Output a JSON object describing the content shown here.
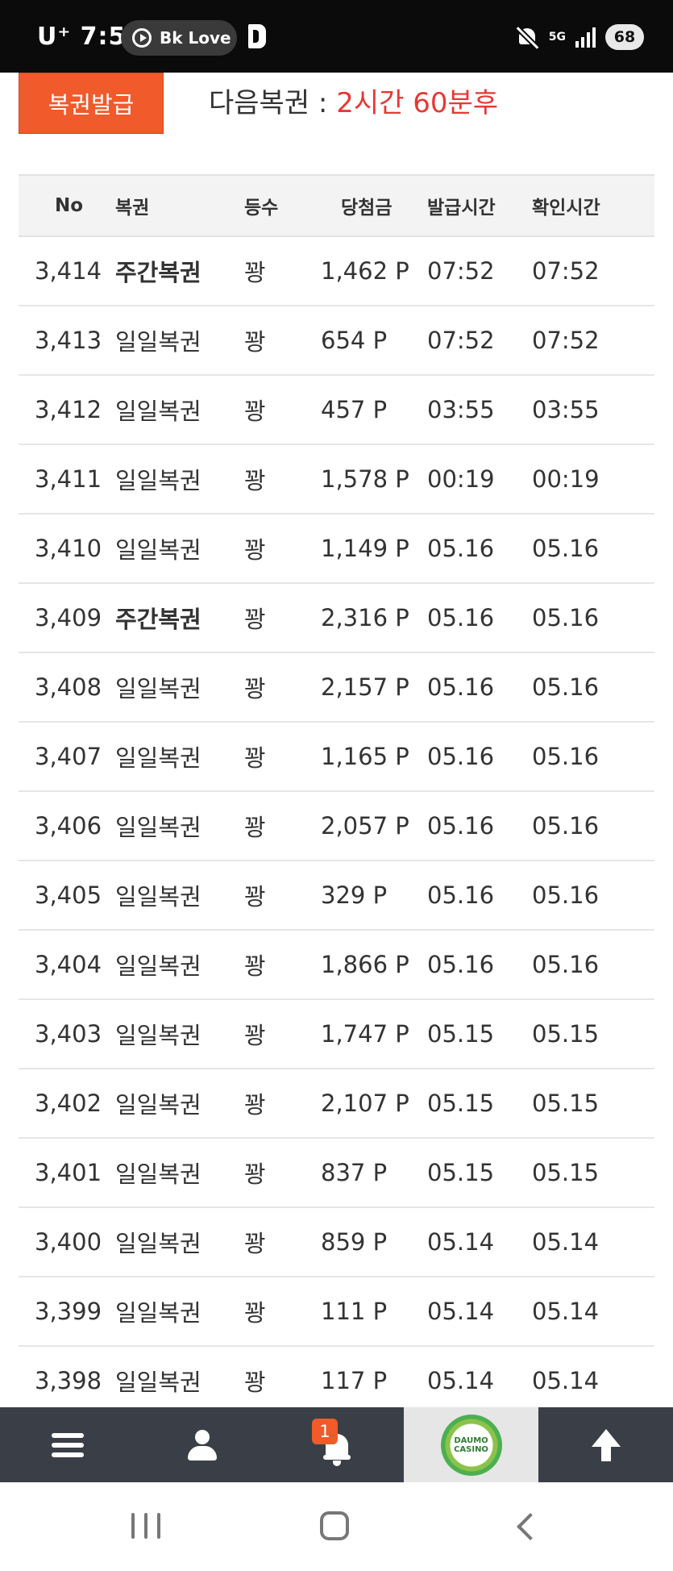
{
  "status_bar": {
    "carrier": "U⁺ 7:53",
    "media_pill_label": "Bk Love",
    "network": "5G",
    "battery": "68",
    "icons": [
      "play-icon",
      "b-app-icon",
      "mute-icon",
      "signal-icon",
      "battery-icon"
    ]
  },
  "top": {
    "issue_button_label": "복권발급",
    "next_label": "다음복권 : ",
    "next_value": "2시간 60분후"
  },
  "table": {
    "headers": [
      "No",
      "복권",
      "등수",
      "당첨금",
      "발급시간",
      "확인시간"
    ],
    "rows": [
      {
        "no": "3,414",
        "type": "주간복권",
        "rank": "꽝",
        "prize": "1,462 P",
        "issued": "07:52",
        "checked": "07:52"
      },
      {
        "no": "3,413",
        "type": "일일복권",
        "rank": "꽝",
        "prize": "654 P",
        "issued": "07:52",
        "checked": "07:52"
      },
      {
        "no": "3,412",
        "type": "일일복권",
        "rank": "꽝",
        "prize": "457 P",
        "issued": "03:55",
        "checked": "03:55"
      },
      {
        "no": "3,411",
        "type": "일일복권",
        "rank": "꽝",
        "prize": "1,578 P",
        "issued": "00:19",
        "checked": "00:19"
      },
      {
        "no": "3,410",
        "type": "일일복권",
        "rank": "꽝",
        "prize": "1,149 P",
        "issued": "05.16",
        "checked": "05.16"
      },
      {
        "no": "3,409",
        "type": "주간복권",
        "rank": "꽝",
        "prize": "2,316 P",
        "issued": "05.16",
        "checked": "05.16"
      },
      {
        "no": "3,408",
        "type": "일일복권",
        "rank": "꽝",
        "prize": "2,157 P",
        "issued": "05.16",
        "checked": "05.16"
      },
      {
        "no": "3,407",
        "type": "일일복권",
        "rank": "꽝",
        "prize": "1,165 P",
        "issued": "05.16",
        "checked": "05.16"
      },
      {
        "no": "3,406",
        "type": "일일복권",
        "rank": "꽝",
        "prize": "2,057 P",
        "issued": "05.16",
        "checked": "05.16"
      },
      {
        "no": "3,405",
        "type": "일일복권",
        "rank": "꽝",
        "prize": "329 P",
        "issued": "05.16",
        "checked": "05.16"
      },
      {
        "no": "3,404",
        "type": "일일복권",
        "rank": "꽝",
        "prize": "1,866 P",
        "issued": "05.16",
        "checked": "05.16"
      },
      {
        "no": "3,403",
        "type": "일일복권",
        "rank": "꽝",
        "prize": "1,747 P",
        "issued": "05.15",
        "checked": "05.15"
      },
      {
        "no": "3,402",
        "type": "일일복권",
        "rank": "꽝",
        "prize": "2,107 P",
        "issued": "05.15",
        "checked": "05.15"
      },
      {
        "no": "3,401",
        "type": "일일복권",
        "rank": "꽝",
        "prize": "837 P",
        "issued": "05.15",
        "checked": "05.15"
      },
      {
        "no": "3,400",
        "type": "일일복권",
        "rank": "꽝",
        "prize": "859 P",
        "issued": "05.14",
        "checked": "05.14"
      },
      {
        "no": "3,399",
        "type": "일일복권",
        "rank": "꽝",
        "prize": "111 P",
        "issued": "05.14",
        "checked": "05.14"
      },
      {
        "no": "3,398",
        "type": "일일복권",
        "rank": "꽝",
        "prize": "117 P",
        "issued": "05.14",
        "checked": "05.14"
      }
    ],
    "bold_type": "주간복권"
  },
  "bottom_nav": {
    "notification_count": "1",
    "logo_text_1": "DAUMO",
    "logo_text_2": "CASINO",
    "icons": [
      "menu-icon",
      "user-icon",
      "bell-icon",
      "casino-logo",
      "arrow-up-icon"
    ]
  },
  "colors": {
    "accent": "#f15a2b",
    "highlight_red": "#e53935",
    "nav_bg": "#3a3f47"
  }
}
